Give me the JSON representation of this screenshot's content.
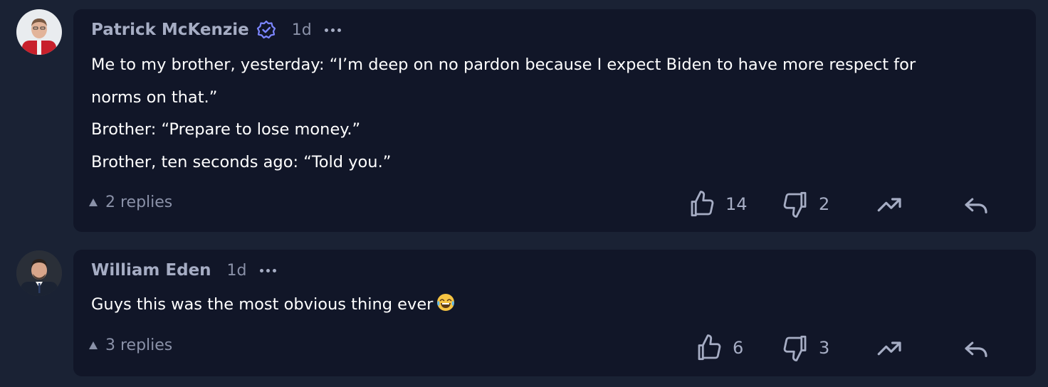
{
  "comments": [
    {
      "author": "Patrick McKenzie",
      "verified": true,
      "time": "1d",
      "lines": [
        "Me to my brother, yesterday: “I’m deep on no pardon because I expect Biden to have more respect for",
        "norms on that.”",
        "Brother: “Prepare to lose money.”",
        "Brother, ten seconds ago: “Told you.”"
      ],
      "replies_label": "2 replies",
      "likes": "14",
      "dislikes": "2"
    },
    {
      "author": "William Eden",
      "verified": false,
      "time": "1d",
      "text": "Guys this was the most obvious thing ever",
      "emoji": "face-with-tears-of-joy",
      "replies_label": "3 replies",
      "likes": "6",
      "dislikes": "3"
    }
  ],
  "colors": {
    "background": "#1a2234",
    "card": "#111628",
    "verified": "#7c86ff",
    "muted": "#8a91a8"
  }
}
